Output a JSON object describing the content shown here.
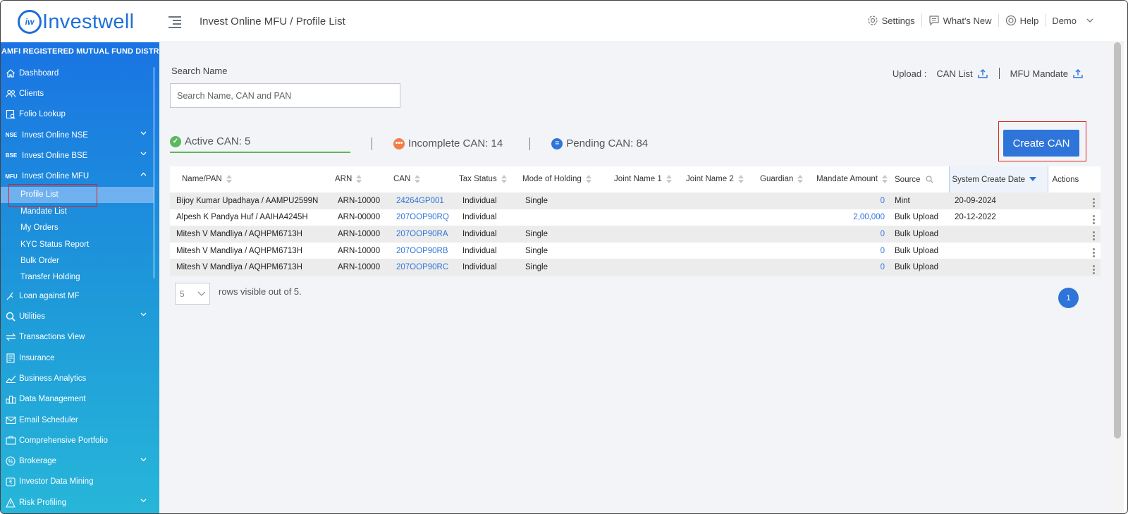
{
  "header": {
    "logo_text": "Investwell",
    "logo_mark": "iw",
    "breadcrumb": "Invest Online MFU / Profile List",
    "settings_label": "Settings",
    "whats_new_label": "What's New",
    "help_label": "Help",
    "user_label": "Demo"
  },
  "sidebar": {
    "org_label": "AMFI REGISTERED MUTUAL FUND DISTRIBUTOR",
    "items": [
      {
        "label": "Dashboard",
        "icon": "home-icon"
      },
      {
        "label": "Clients",
        "icon": "users-icon"
      },
      {
        "label": "Folio Lookup",
        "icon": "folio-icon"
      },
      {
        "label": "Invest Online NSE",
        "icon_text": "NSE",
        "expandable": true
      },
      {
        "label": "Invest Online BSE",
        "icon_text": "BSE",
        "expandable": true
      },
      {
        "label": "Invest Online MFU",
        "icon_text": "MFU",
        "expandable": true,
        "expanded": true
      }
    ],
    "sub_items": [
      "Profile List",
      "Mandate List",
      "My Orders",
      "KYC Status Report",
      "Bulk Order",
      "Transfer Holding"
    ],
    "items_after": [
      {
        "label": "Loan against MF",
        "icon": "loan-icon"
      },
      {
        "label": "Utilities",
        "icon": "utilities-icon",
        "expandable": true
      },
      {
        "label": "Transactions View",
        "icon": "transactions-icon"
      },
      {
        "label": "Insurance",
        "icon": "insurance-icon"
      },
      {
        "label": "Business Analytics",
        "icon": "analytics-icon"
      },
      {
        "label": "Data Management",
        "icon": "data-icon"
      },
      {
        "label": "Email Scheduler",
        "icon": "email-icon"
      },
      {
        "label": "Comprehensive Portfolio",
        "icon": "portfolio-icon"
      },
      {
        "label": "Brokerage",
        "icon": "brokerage-icon",
        "expandable": true
      },
      {
        "label": "Investor Data Mining",
        "icon": "mining-icon"
      },
      {
        "label": "Risk Profiling",
        "icon": "risk-icon",
        "expandable": true
      }
    ]
  },
  "search": {
    "label": "Search Name",
    "placeholder": "Search Name, CAN and PAN"
  },
  "upload": {
    "label": "Upload :",
    "can_list": "CAN List",
    "mfu_mandate": "MFU Mandate"
  },
  "can_tabs": {
    "active": "Active CAN: 5",
    "incomplete": "Incomplete CAN: 14",
    "pending": "Pending CAN: 84"
  },
  "create_button": "Create CAN",
  "table": {
    "headers": [
      "Name/PAN",
      "ARN",
      "CAN",
      "Tax Status",
      "Mode of Holding",
      "Joint Name 1",
      "Joint Name 2",
      "Guardian",
      "Mandate Amount",
      "Source",
      "System Create Date",
      "Actions"
    ],
    "rows": [
      [
        "Bijoy Kumar Upadhaya / AAMPU2599N",
        "ARN-10000",
        "24264GP001",
        "Individual",
        "Single",
        "",
        "",
        "",
        "0",
        "Mint",
        "20-09-2024"
      ],
      [
        "Alpesh K Pandya Huf / AAIHA4245H",
        "ARN-00000",
        "207OOP90RQ",
        "Individual",
        "",
        "",
        "",
        "",
        "2,00,000",
        "Bulk Upload",
        "20-12-2022"
      ],
      [
        "Mitesh V Mandliya / AQHPM6713H",
        "ARN-10000",
        "207OOP90RA",
        "Individual",
        "Single",
        "",
        "",
        "",
        "0",
        "Bulk Upload",
        ""
      ],
      [
        "Mitesh V Mandliya / AQHPM6713H",
        "ARN-10000",
        "207OOP90RB",
        "Individual",
        "Single",
        "",
        "",
        "",
        "0",
        "Bulk Upload",
        ""
      ],
      [
        "Mitesh V Mandliya / AQHPM6713H",
        "ARN-10000",
        "207OOP90RC",
        "Individual",
        "Single",
        "",
        "",
        "",
        "0",
        "Bulk Upload",
        ""
      ]
    ]
  },
  "pager": {
    "page_size": "5",
    "rows_text": "rows visible out of 5.",
    "current_page": "1"
  },
  "colors": {
    "brand": "#1e6fd9",
    "accent": "#2f75d9",
    "active_green": "#5cb85c",
    "incomplete_orange": "#f0804a",
    "pending_blue": "#2f75d9",
    "highlight_red": "#e02020"
  }
}
